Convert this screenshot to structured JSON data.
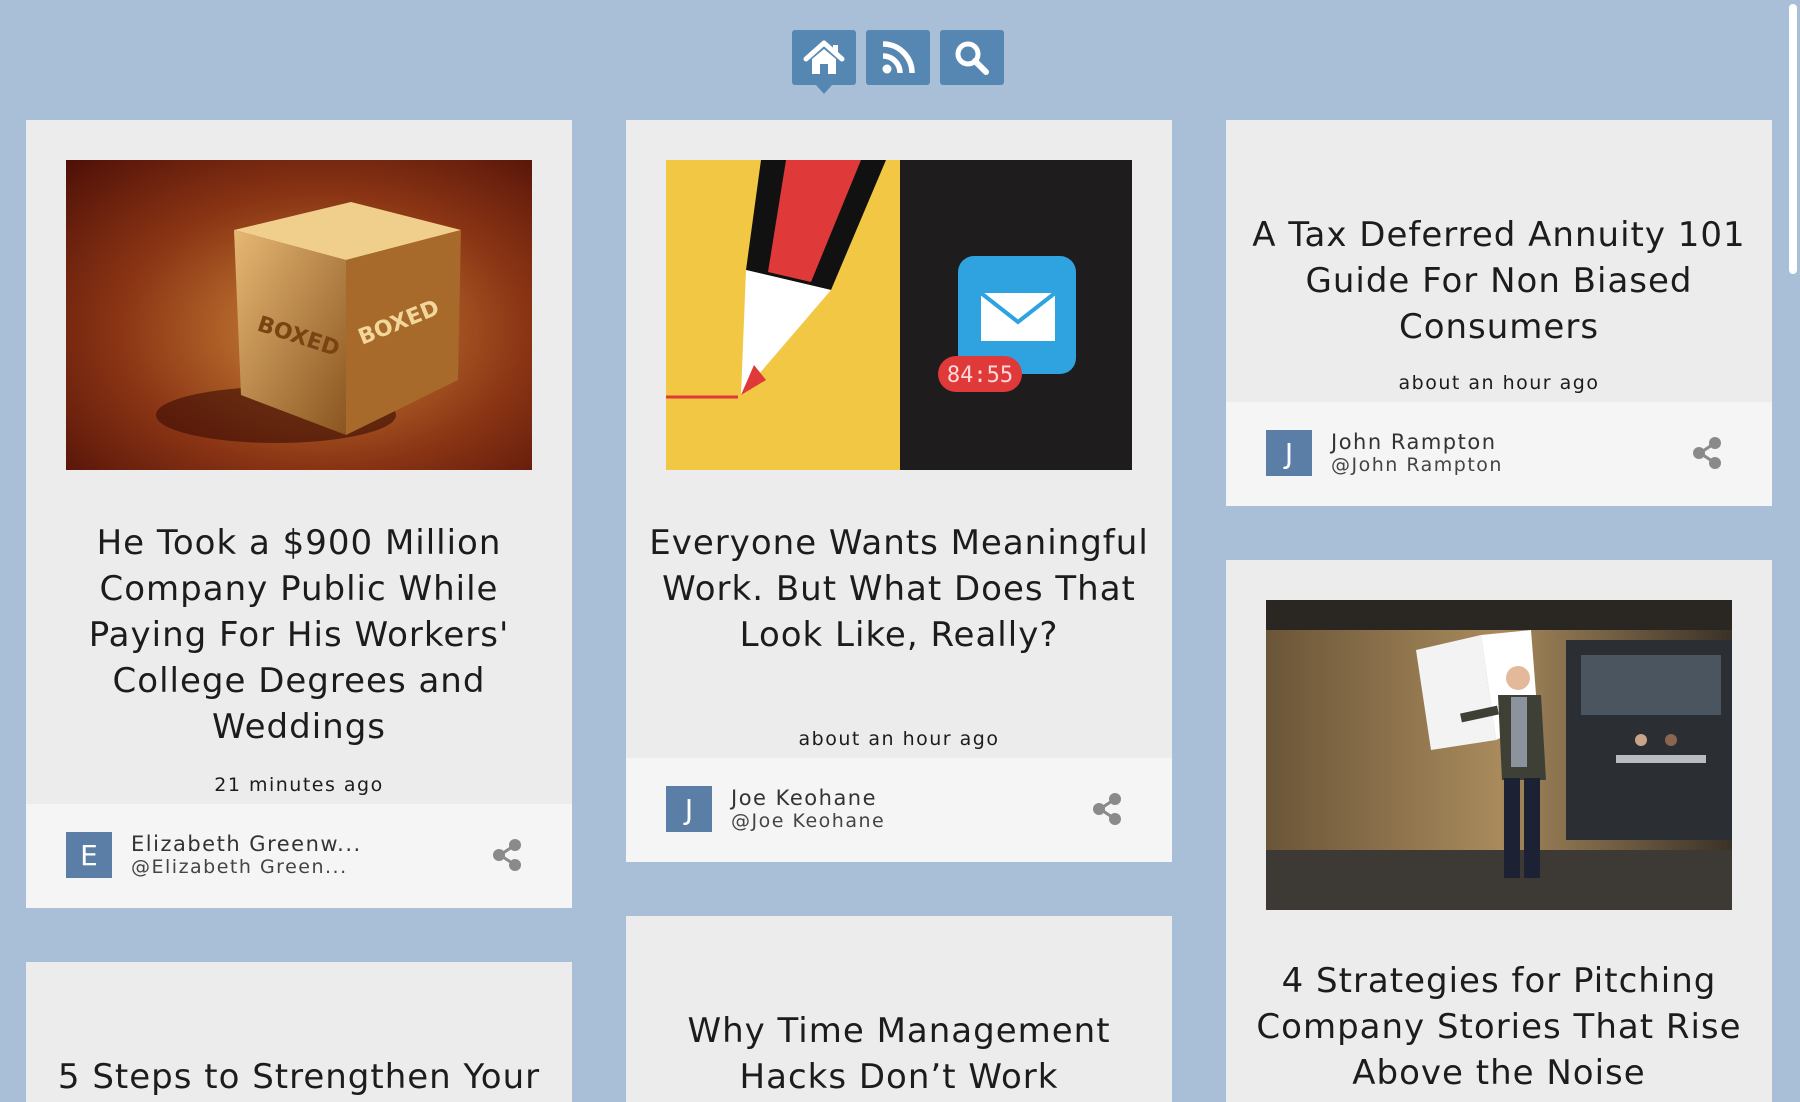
{
  "nav": {
    "home_icon": "home-icon",
    "rss_icon": "rss-icon",
    "search_icon": "search-icon",
    "button_color": "#5587b2"
  },
  "cards": [
    {
      "title": "He Took a $900 Million Company Public While Paying For His Workers' College Degrees and Weddings",
      "time": "21 minutes ago",
      "author": {
        "initial": "E",
        "name": "Elizabeth Greenw...",
        "handle": "@Elizabeth Green..."
      },
      "image": {
        "box_text": "BOXED"
      }
    },
    {
      "title": "Everyone Wants Meaningful Work. But What Does That Look Like, Really?",
      "time": "about an hour ago",
      "author": {
        "initial": "J",
        "name": "Joe Keohane",
        "handle": "@Joe Keohane"
      },
      "image": {
        "counter_text": "84:55"
      }
    },
    {
      "title": "A Tax Deferred Annuity 101 Guide For Non Biased Consumers",
      "time": "about an hour ago",
      "author": {
        "initial": "J",
        "name": "John Rampton",
        "handle": "@John Rampton"
      }
    },
    {
      "title": "4 Strategies for Pitching Company Stories That Rise Above the Noise"
    },
    {
      "title": "Why Time Management Hacks Don’t Work"
    },
    {
      "title": "5 Steps to Strengthen Your"
    }
  ],
  "colors": {
    "background": "#a9bfd8",
    "card": "#ececec",
    "card_footer": "#f5f5f5",
    "avatar": "#5b7ea6"
  }
}
